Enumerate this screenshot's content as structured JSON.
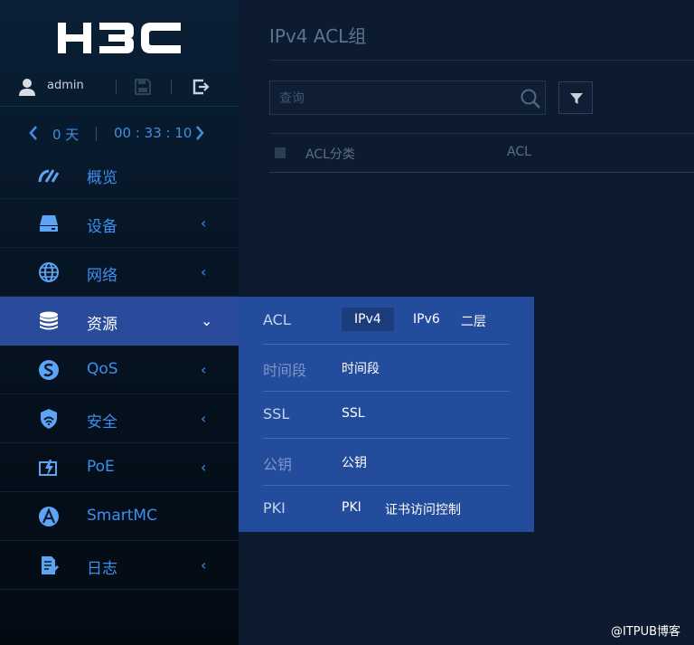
{
  "brand": {
    "logo_text": "H3C"
  },
  "user": {
    "name": "admin"
  },
  "timer": {
    "days": "0 天",
    "time": "00 : 33 : 10"
  },
  "sidebar": {
    "items": [
      {
        "label": "概览",
        "icon": "dashboard-gauge-icon",
        "arrow": ""
      },
      {
        "label": "设备",
        "icon": "device-drive-icon",
        "arrow": "‹"
      },
      {
        "label": "网络",
        "icon": "network-globe-icon",
        "arrow": "‹"
      },
      {
        "label": "资源",
        "icon": "database-stack-icon",
        "arrow": "⌄"
      },
      {
        "label": "QoS",
        "icon": "qos-icon",
        "arrow": "‹"
      },
      {
        "label": "安全",
        "icon": "security-shield-icon",
        "arrow": "‹"
      },
      {
        "label": "PoE",
        "icon": "poe-power-icon",
        "arrow": "‹"
      },
      {
        "label": "SmartMC",
        "icon": "smartmc-icon",
        "arrow": ""
      },
      {
        "label": "日志",
        "icon": "log-document-icon",
        "arrow": "‹"
      }
    ],
    "active_index": 3
  },
  "main": {
    "title": "IPv4 ACL组",
    "search": {
      "placeholder": "查询"
    },
    "table": {
      "columns": [
        "ACL分类",
        "ACL"
      ]
    }
  },
  "flyout": {
    "rows": [
      {
        "category": "ACL",
        "links": [
          "IPv4",
          "IPv6",
          "二层"
        ]
      },
      {
        "category": "时间段",
        "links": [
          "时间段"
        ]
      },
      {
        "category": "SSL",
        "links": [
          "SSL"
        ]
      },
      {
        "category": "公钥",
        "links": [
          "公钥"
        ]
      },
      {
        "category": "PKI",
        "links": [
          "PKI",
          "证书访问控制"
        ]
      }
    ]
  },
  "watermark": "@ITPUB博客",
  "colors": {
    "accent": "#3c8ff0",
    "active_bg": "#2a4b9c",
    "flyout_bg": "#244c9c"
  }
}
